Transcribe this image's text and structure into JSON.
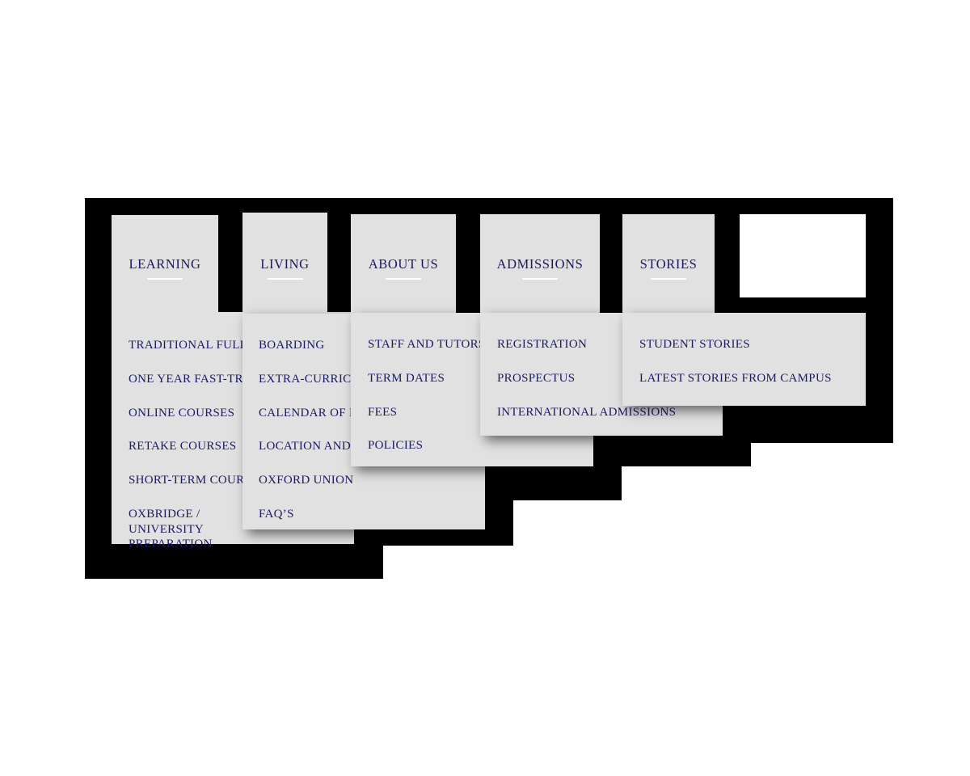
{
  "menu": {
    "background_color": "#000000",
    "panel_color": "#e1e1e1",
    "text_color": "#1a1a66",
    "rule_color": "#ffffff",
    "columns": [
      {
        "id": "learning",
        "title": "LEARNING",
        "items": [
          "TRADITIONAL FULL-TIME COURSES",
          "ONE YEAR FAST-TRACK COURSES",
          "ONLINE COURSES",
          "RETAKE COURSES",
          "SHORT-TERM COURSES",
          "OXBRIDGE / UNIVERSITY PREPARATION"
        ]
      },
      {
        "id": "living",
        "title": "LIVING",
        "items": [
          "BOARDING",
          "EXTRA-CURRICULAR",
          "CALENDAR OF EVENTS",
          "LOCATION AND BUILDINGS",
          "OXFORD UNION",
          "FAQ’S"
        ]
      },
      {
        "id": "about-us",
        "title": "ABOUT US",
        "items": [
          "STAFF AND TUTORS",
          "TERM DATES",
          "FEES",
          "POLICIES"
        ]
      },
      {
        "id": "admissions",
        "title": "ADMISSIONS",
        "items": [
          "REGISTRATION",
          "PROSPECTUS",
          "INTERNATIONAL ADMISSIONS"
        ]
      },
      {
        "id": "stories",
        "title": "STORIES",
        "items": [
          "STUDENT STORIES",
          "LATEST STORIES FROM CAMPUS"
        ]
      }
    ]
  }
}
